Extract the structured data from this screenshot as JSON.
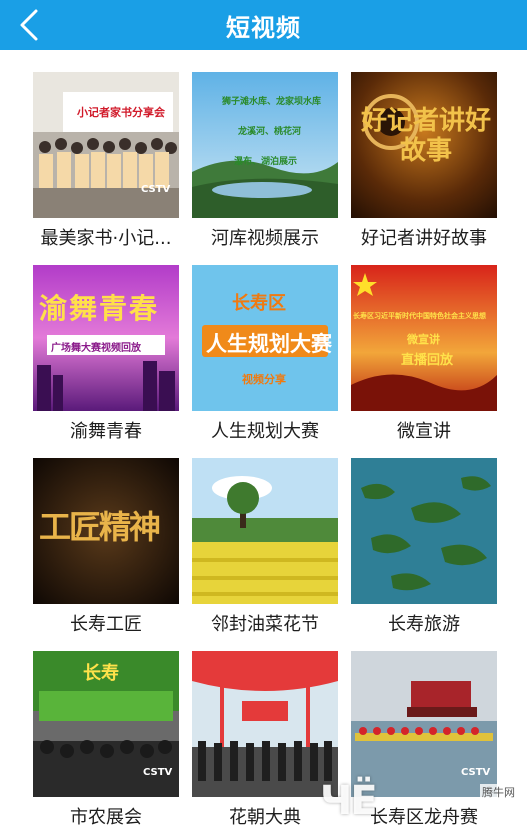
{
  "header": {
    "title": "短视频",
    "back_icon": "chevron-left-icon"
  },
  "colors": {
    "header_bg": "#1a9fe6",
    "caption_text": "#1e1e1e"
  },
  "videos": [
    {
      "title": "最美家书·小记...",
      "thumb_text": "小记者家书分享会",
      "badge": "CSTV"
    },
    {
      "title": "河库视频展示",
      "thumb_lines": [
        "狮子滩水库、龙家坝水库",
        "龙溪河、桃花河",
        "瀑布、湖泊展示"
      ]
    },
    {
      "title": "好记者讲好故事",
      "thumb_text": "好记者讲好故事"
    },
    {
      "title": "渝舞青春",
      "thumb_text": "渝舞青春",
      "thumb_sub": "广场舞大赛视频回放"
    },
    {
      "title": "人生规划大赛",
      "thumb_top": "长寿区",
      "thumb_text": "人生规划大赛",
      "thumb_sub": "视频分享"
    },
    {
      "title": "微宣讲",
      "thumb_lines": [
        "长寿区习近平新时代中国特色社会主义思想",
        "微宣讲",
        "直播回放"
      ]
    },
    {
      "title": "长寿工匠",
      "thumb_text": "工匠精神"
    },
    {
      "title": "邻封油菜花节"
    },
    {
      "title": "长寿旅游"
    },
    {
      "title": "市农展会",
      "thumb_text": "长寿",
      "badge": "CSTV"
    },
    {
      "title": "花朝大典"
    },
    {
      "title": "长寿区龙舟赛",
      "badge": "CSTV"
    }
  ],
  "watermark": {
    "logo": "ЧЁ",
    "site": "腾牛网"
  }
}
